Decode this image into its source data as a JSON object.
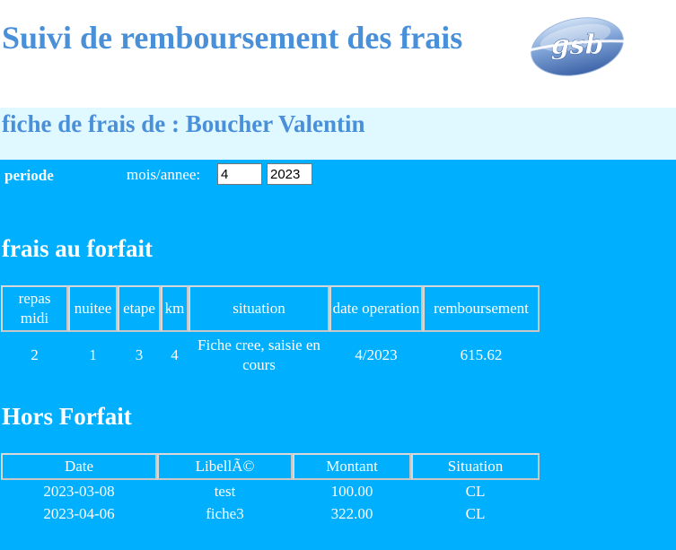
{
  "header": {
    "title": "Suivi de remboursement des frais",
    "logo_text": "gsb"
  },
  "fiche": {
    "title": "fiche de frais de : Boucher Valentin"
  },
  "periode": {
    "label": "periode",
    "mois_annee_label": "mois/annee:",
    "mois_value": "4",
    "annee_value": "2023"
  },
  "forfait": {
    "title": "frais au forfait",
    "headers": [
      "repas midi",
      "nuitee",
      "etape",
      "km",
      "situation",
      "date operation",
      "remboursement"
    ],
    "rows": [
      [
        "2",
        "1",
        "3",
        "4",
        "Fiche cree, saisie en cours",
        "4/2023",
        "615.62"
      ]
    ]
  },
  "hors_forfait": {
    "title": "Hors Forfait",
    "headers": [
      "Date",
      "LibellÃ©",
      "Montant",
      "Situation"
    ],
    "rows": [
      [
        "2023-03-08",
        "test",
        "100.00",
        "CL"
      ],
      [
        "2023-04-06",
        "fiche3",
        "322.00",
        "CL"
      ]
    ]
  },
  "colors": {
    "title_blue": "#4a90d9",
    "band_light": "#e0f8ff",
    "main_bg": "#00b0ff"
  }
}
